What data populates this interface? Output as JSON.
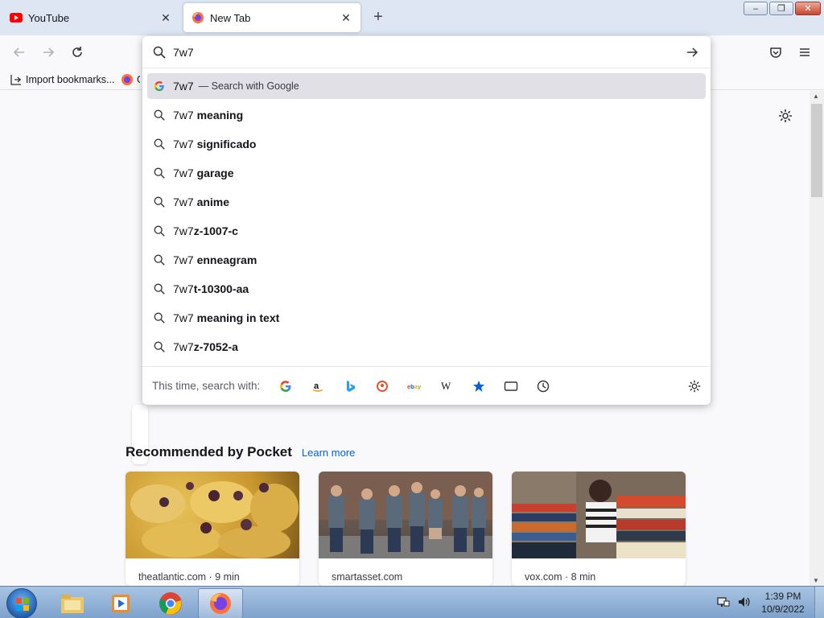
{
  "tabs": [
    {
      "title": "YouTube",
      "favicon": "youtube-icon",
      "active": false
    },
    {
      "title": "New Tab",
      "favicon": "firefox-icon",
      "active": true
    }
  ],
  "tab_close_glyph": "✕",
  "new_tab_glyph": "+",
  "window_controls": {
    "minimize": "–",
    "maximize": "❐",
    "close": "✕"
  },
  "bookmarks": {
    "import_label": "Import bookmarks...",
    "item2_label": "G"
  },
  "urlbar": {
    "query": "7w7",
    "suggestions": [
      {
        "prefix": "7w7",
        "suffix": "",
        "action": "— Search with Google",
        "icon": "google-icon",
        "selected": true
      },
      {
        "prefix": "7w7 ",
        "suffix": "meaning",
        "action": "",
        "icon": "search-icon",
        "selected": false
      },
      {
        "prefix": "7w7 ",
        "suffix": "significado",
        "action": "",
        "icon": "search-icon",
        "selected": false
      },
      {
        "prefix": "7w7 ",
        "suffix": "garage",
        "action": "",
        "icon": "search-icon",
        "selected": false
      },
      {
        "prefix": "7w7 ",
        "suffix": "anime",
        "action": "",
        "icon": "search-icon",
        "selected": false
      },
      {
        "prefix": "7w7",
        "suffix": "z-1007-c",
        "action": "",
        "icon": "search-icon",
        "selected": false
      },
      {
        "prefix": "7w7 ",
        "suffix": "enneagram",
        "action": "",
        "icon": "search-icon",
        "selected": false
      },
      {
        "prefix": "7w7",
        "suffix": "t-10300-aa",
        "action": "",
        "icon": "search-icon",
        "selected": false
      },
      {
        "prefix": "7w7 ",
        "suffix": "meaning in text",
        "action": "",
        "icon": "search-icon",
        "selected": false
      },
      {
        "prefix": "7w7",
        "suffix": "z-7052-a",
        "action": "",
        "icon": "search-icon",
        "selected": false
      }
    ],
    "oneoff_label": "This time, search with:",
    "engines": [
      "google",
      "amazon",
      "bing",
      "duckduckgo",
      "ebay",
      "wikipedia",
      "bookmarks",
      "tabs",
      "history"
    ]
  },
  "pocket": {
    "title": "Recommended by Pocket",
    "learn_more": "Learn more",
    "cards": [
      {
        "source": "theatlantic.com · 9 min",
        "image": "food-image"
      },
      {
        "source": "smartasset.com",
        "image": "group-photo-image"
      },
      {
        "source": "vox.com · 8 min",
        "image": "library-books-image"
      }
    ]
  },
  "taskbar": {
    "time": "1:39 PM",
    "date": "10/9/2022"
  },
  "colors": {
    "accent_link": "#0061e0",
    "selected_row": "#e0e0e6",
    "tabstrip": "#dde6f2"
  }
}
